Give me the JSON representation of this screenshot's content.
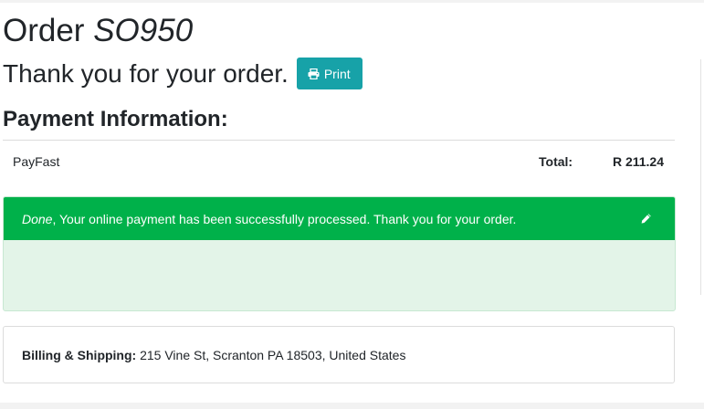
{
  "header": {
    "order_prefix": "Order",
    "order_ref": "SO950",
    "thanks": "Thank you for your order.",
    "print_label": "Print"
  },
  "payment": {
    "title": "Payment Information:",
    "provider": "PayFast",
    "total_label": "Total:",
    "total_value": "R 211.24"
  },
  "alert": {
    "status": "Done",
    "message": ", Your online payment has been successfully processed. Thank you for your order.",
    "color": "#00b14a",
    "body_color": "#e3f4e8"
  },
  "address": {
    "label": "Billing & Shipping:",
    "value": "215 Vine St, Scranton PA 18503, United States"
  },
  "icons": {
    "print": "print-icon",
    "edit": "pencil-icon"
  },
  "colors": {
    "print_button": "#17a2a8"
  }
}
